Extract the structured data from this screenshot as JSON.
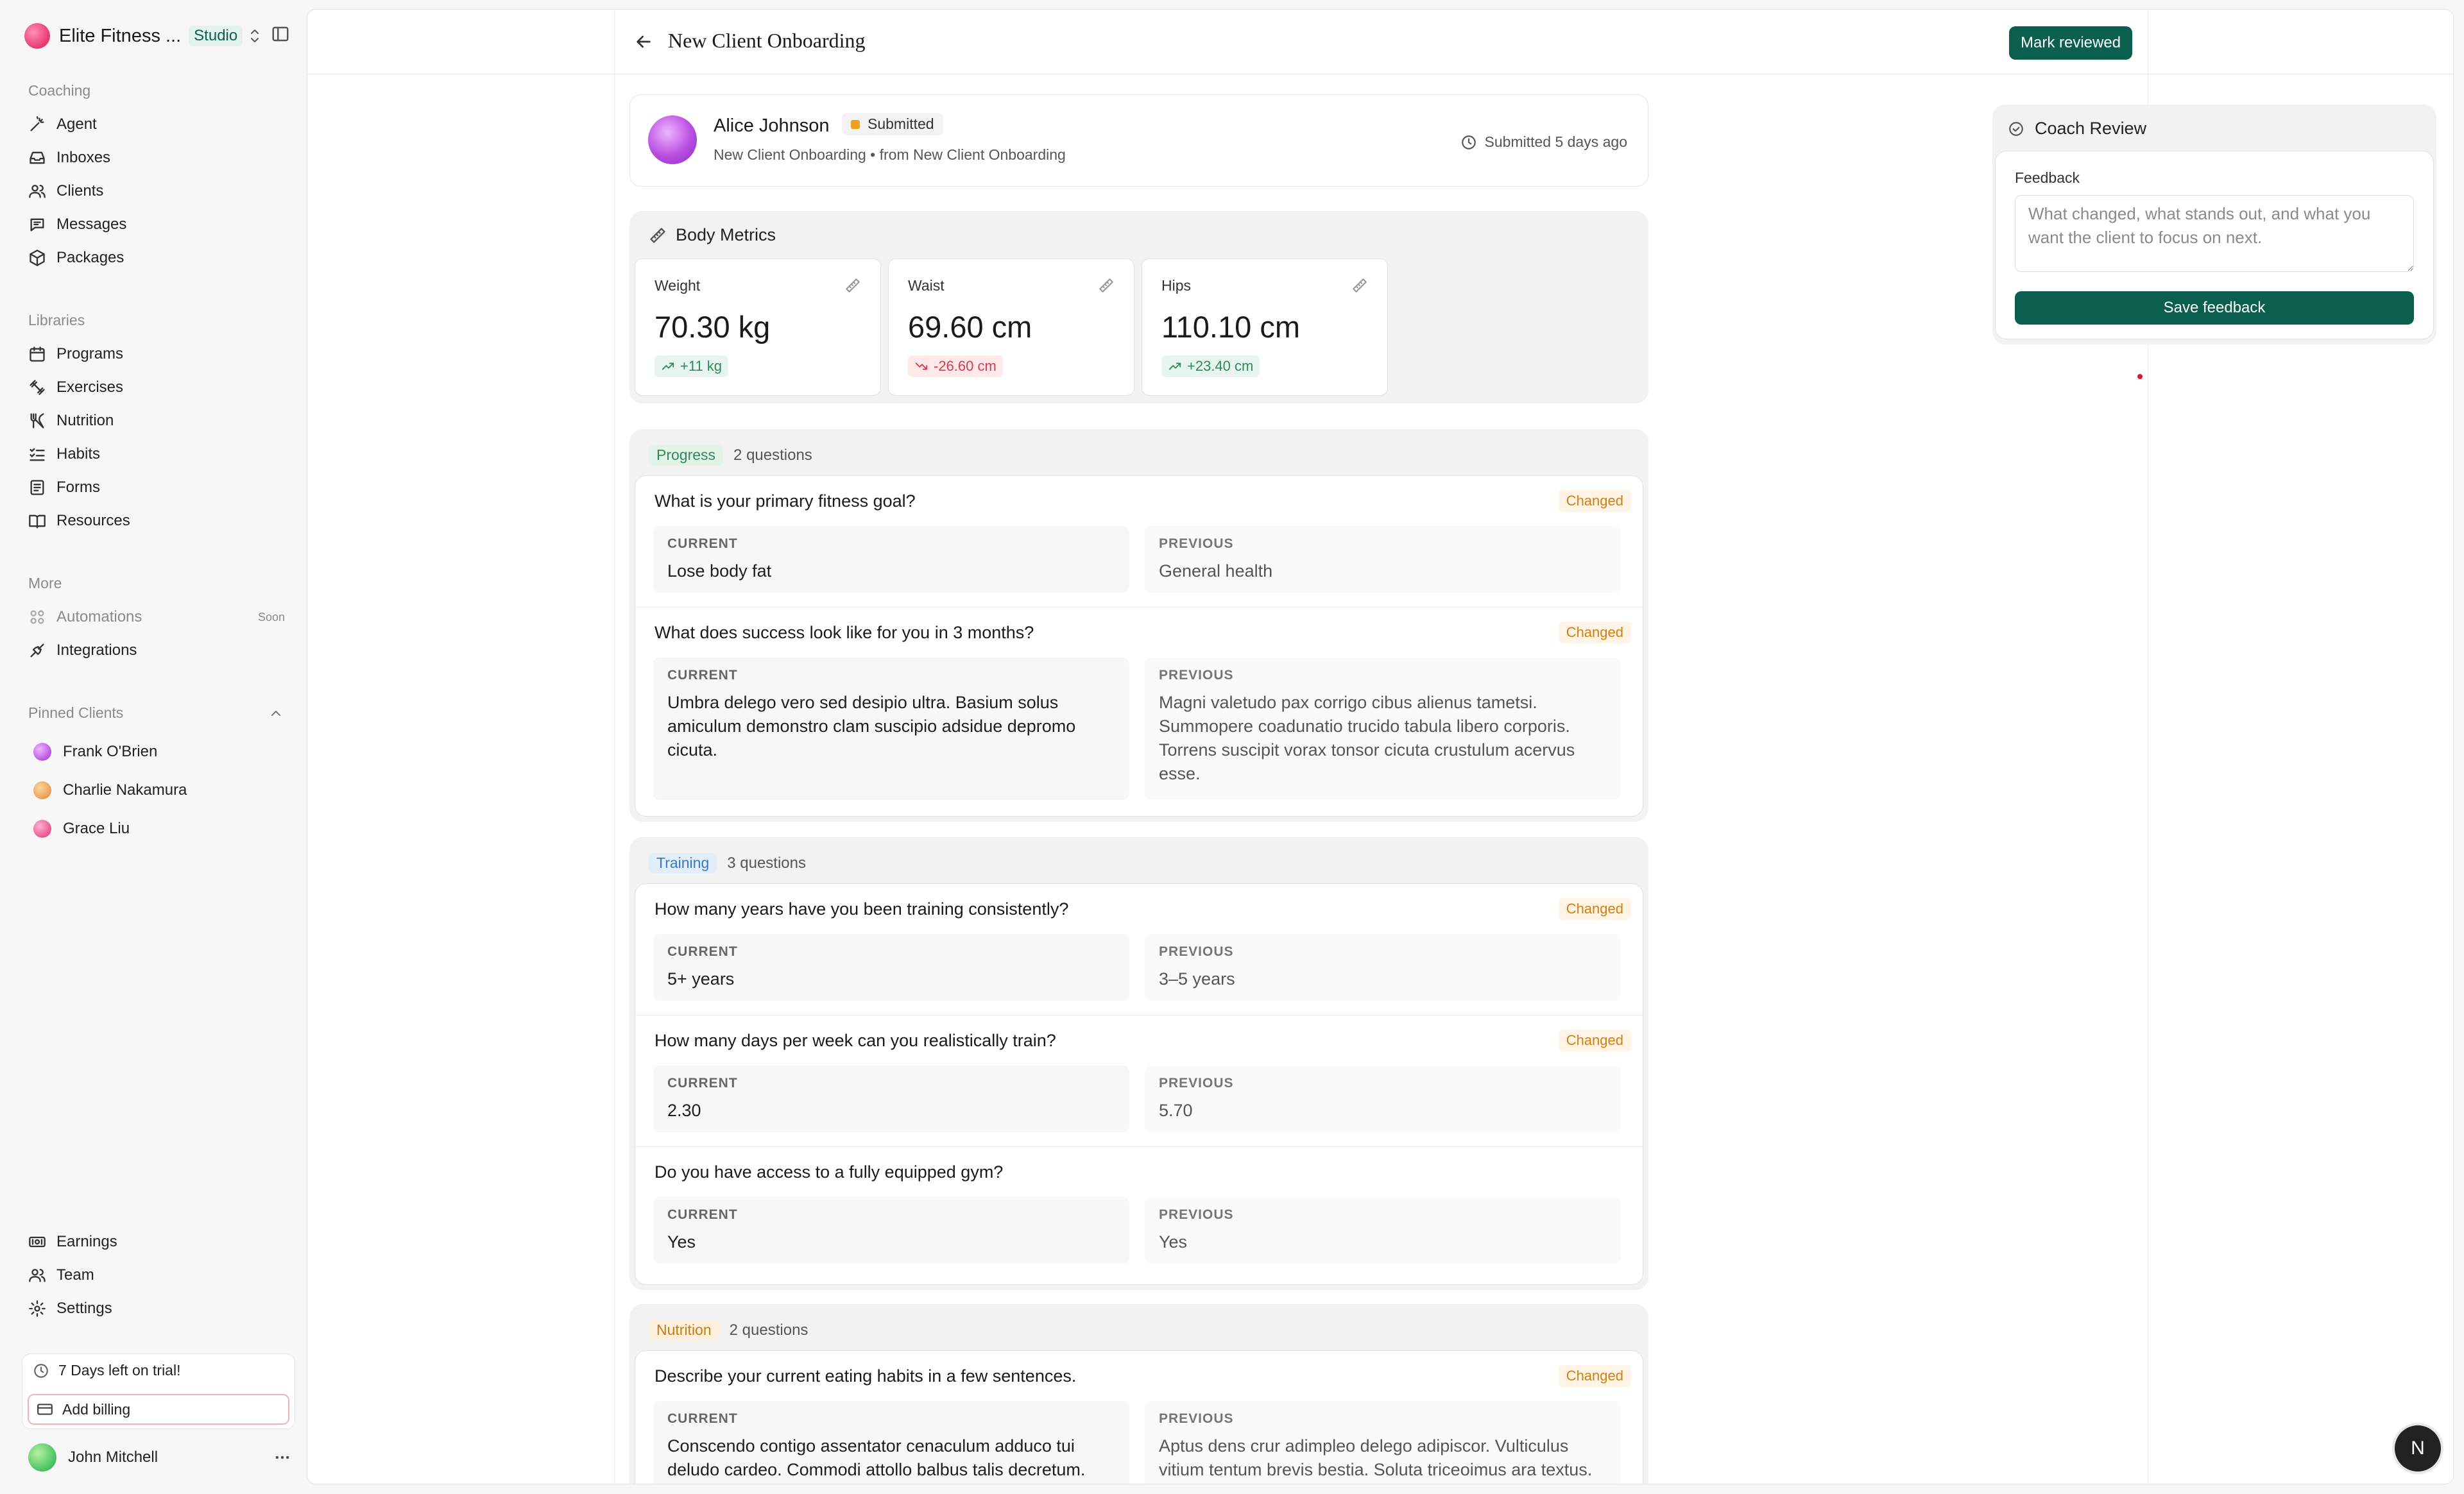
{
  "workspace": {
    "name": "Elite Fitness ...",
    "plan_badge": "Studio"
  },
  "sidebar": {
    "coaching_heading": "Coaching",
    "coaching": [
      {
        "label": "Agent",
        "icon": "sparkle-wand-icon"
      },
      {
        "label": "Inboxes",
        "icon": "inbox-icon"
      },
      {
        "label": "Clients",
        "icon": "users-icon"
      },
      {
        "label": "Messages",
        "icon": "message-icon"
      },
      {
        "label": "Packages",
        "icon": "package-icon"
      }
    ],
    "libraries_heading": "Libraries",
    "libraries": [
      {
        "label": "Programs",
        "icon": "calendar-icon"
      },
      {
        "label": "Exercises",
        "icon": "dumbbell-icon"
      },
      {
        "label": "Nutrition",
        "icon": "utensils-icon"
      },
      {
        "label": "Habits",
        "icon": "checklist-icon"
      },
      {
        "label": "Forms",
        "icon": "form-icon"
      },
      {
        "label": "Resources",
        "icon": "book-icon"
      }
    ],
    "more_heading": "More",
    "more": [
      {
        "label": "Automations",
        "icon": "grid-icon",
        "badge": "Soon"
      },
      {
        "label": "Integrations",
        "icon": "plug-icon"
      }
    ],
    "pinned_heading": "Pinned Clients",
    "pinned": [
      {
        "label": "Frank O'Brien",
        "color": "#b44ce0"
      },
      {
        "label": "Charlie Nakamura",
        "color": "#e89a4a"
      },
      {
        "label": "Grace Liu",
        "color": "#e8508a"
      }
    ],
    "bottom": [
      {
        "label": "Earnings",
        "icon": "money-icon"
      },
      {
        "label": "Team",
        "icon": "team-icon"
      },
      {
        "label": "Settings",
        "icon": "gear-icon"
      }
    ],
    "trial_text": "7 Days left on trial!",
    "billing_label": "Add billing",
    "user_name": "John Mitchell"
  },
  "page": {
    "title": "New Client Onboarding",
    "mark_reviewed": "Mark reviewed"
  },
  "client": {
    "name": "Alice Johnson",
    "status": "Submitted",
    "subtitle": "New Client Onboarding • from New Client Onboarding",
    "submitted": "Submitted 5 days ago"
  },
  "metrics": {
    "title": "Body Metrics",
    "items": [
      {
        "label": "Weight",
        "value": "70.30 kg",
        "delta": "+11 kg",
        "direction": "up"
      },
      {
        "label": "Waist",
        "value": "69.60 cm",
        "delta": "-26.60 cm",
        "direction": "down"
      },
      {
        "label": "Hips",
        "value": "110.10 cm",
        "delta": "+23.40 cm",
        "direction": "up"
      }
    ]
  },
  "labels": {
    "current": "CURRENT",
    "previous": "PREVIOUS",
    "changed": "Changed"
  },
  "groups": [
    {
      "tag": "Progress",
      "count": "2 questions",
      "tag_bg": "#e4f3ea",
      "tag_color": "#2f8a57",
      "questions": [
        {
          "q": "What is your primary fitness goal?",
          "changed": true,
          "current": "Lose body fat",
          "previous": "General health"
        },
        {
          "q": "What does success look like for you in 3 months?",
          "changed": true,
          "current": "Umbra delego vero sed desipio ultra. Basium solus amiculum demonstro clam suscipio adsidue depromo cicuta.",
          "previous": "Magni valetudo pax corrigo cibus alienus tametsi. Summopere coadunatio trucido tabula libero corporis. Torrens suscipit vorax tonsor cicuta crustulum acervus esse."
        }
      ]
    },
    {
      "tag": "Training",
      "count": "3 questions",
      "tag_bg": "#e3eefa",
      "tag_color": "#3a78c2",
      "questions": [
        {
          "q": "How many years have you been training consistently?",
          "changed": true,
          "current": "5+ years",
          "previous": "3–5 years"
        },
        {
          "q": "How many days per week can you realistically train?",
          "changed": true,
          "current": "2.30",
          "previous": "5.70"
        },
        {
          "q": "Do you have access to a fully equipped gym?",
          "changed": false,
          "current": "Yes",
          "previous": "Yes"
        }
      ]
    },
    {
      "tag": "Nutrition",
      "count": "2 questions",
      "tag_bg": "#fdf0dc",
      "tag_color": "#c77c12",
      "questions": [
        {
          "q": "Describe your current eating habits in a few sentences.",
          "changed": true,
          "current": "Conscendo contigo assentator cenaculum adduco tui deludo cardeo. Commodi attollo balbus talis decretum.",
          "previous": "Aptus dens crur adimpleo delego adipiscor. Vulticulus vitium tentum brevis bestia. Soluta triceoimus ara textus."
        }
      ]
    }
  ],
  "review": {
    "title": "Coach Review",
    "feedback_label": "Feedback",
    "placeholder": "What changed, what stands out, and what you want the client to focus on next.",
    "save_label": "Save feedback"
  },
  "fab_label": "N"
}
